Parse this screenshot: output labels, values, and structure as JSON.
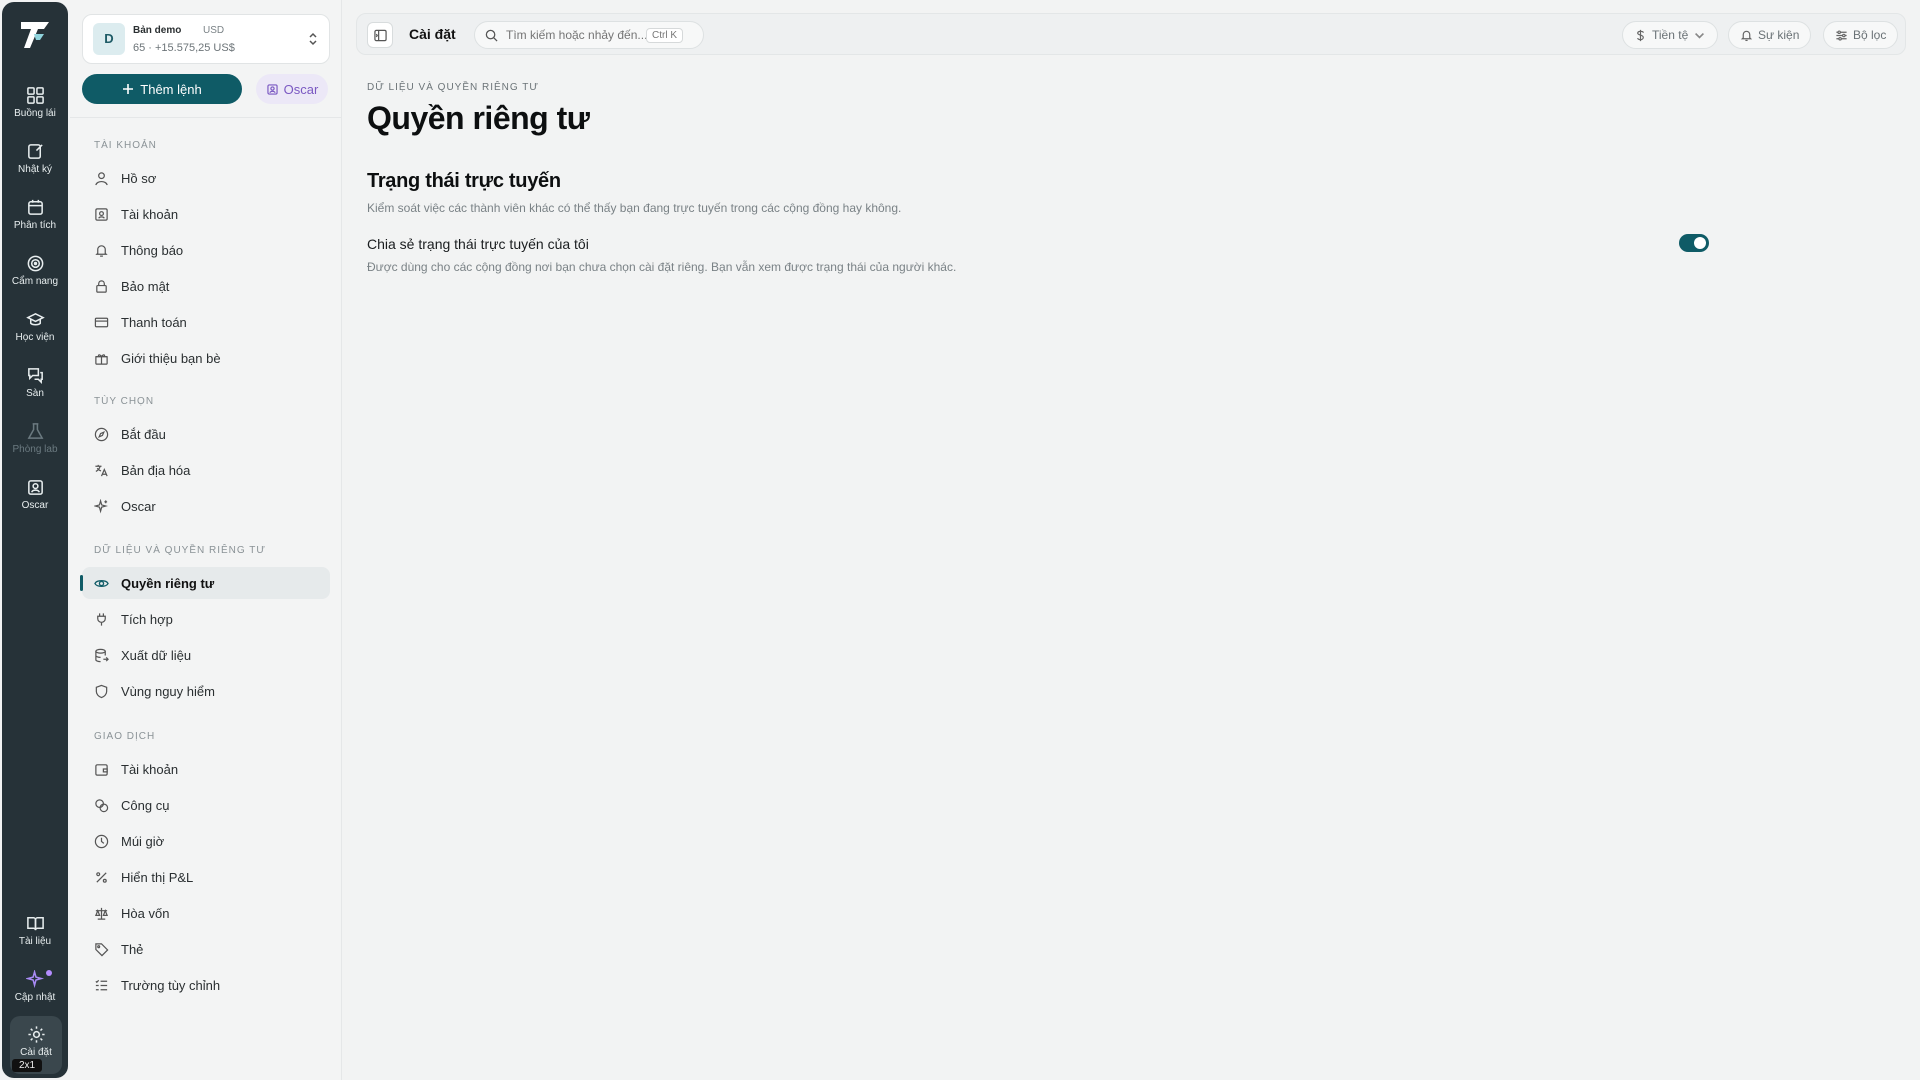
{
  "rail": {
    "items": [
      {
        "label": "Buồng lái",
        "icon": "dashboard-icon"
      },
      {
        "label": "Nhật ký",
        "icon": "journal-icon"
      },
      {
        "label": "Phân tích",
        "icon": "analytics-icon"
      },
      {
        "label": "Cẩm nang",
        "icon": "target-icon"
      },
      {
        "label": "Học viện",
        "icon": "graduation-cap-icon"
      },
      {
        "label": "Sàn",
        "icon": "chat-icon"
      },
      {
        "label": "Phòng lab",
        "icon": "flask-icon"
      },
      {
        "label": "Oscar",
        "icon": "oscar-icon"
      }
    ],
    "bottom": [
      {
        "label": "Tài liệu",
        "icon": "book-icon"
      },
      {
        "label": "Cập nhật",
        "icon": "sparkle-icon"
      }
    ],
    "settings_label": "Cài đặt",
    "zoom_badge": "2x1"
  },
  "account": {
    "avatar": "D",
    "name": "Bản demo",
    "currency": "USD",
    "summary": "65 · +15.575,25 US$"
  },
  "actions": {
    "add_order": "Thêm lệnh",
    "oscar": "Oscar"
  },
  "sidebar": {
    "sections": [
      {
        "title": "Tài khoản",
        "items": [
          "Hồ sơ",
          "Tài khoản",
          "Thông báo",
          "Bảo mật",
          "Thanh toán",
          "Giới thiệu bạn bè"
        ]
      },
      {
        "title": "Tùy chọn",
        "items": [
          "Bắt đầu",
          "Bản địa hóa",
          "Oscar"
        ]
      },
      {
        "title": "Dữ liệu và quyền riêng tư",
        "items": [
          "Quyền riêng tư",
          "Tích hợp",
          "Xuất dữ liệu",
          "Vùng nguy hiểm"
        ]
      },
      {
        "title": "Giao dịch",
        "items": [
          "Tài khoản",
          "Công cụ",
          "Múi giờ",
          "Hiển thị P&L",
          "Hòa vốn",
          "Thẻ",
          "Trường tùy chỉnh"
        ]
      }
    ],
    "active_item": "Quyền riêng tư"
  },
  "topbar": {
    "title": "Cài đặt",
    "search_placeholder": "Tìm kiếm hoặc nhảy đến...",
    "search_shortcut": "Ctrl K",
    "currency_btn": "Tiền tệ",
    "events_btn": "Sự kiện",
    "filter_btn": "Bộ lọc"
  },
  "main": {
    "breadcrumb": "Dữ liệu và quyền riêng tư",
    "title": "Quyền riêng tư",
    "section_title": "Trạng thái trực tuyến",
    "section_desc": "Kiểm soát việc các thành viên khác có thể thấy bạn đang trực tuyến trong các cộng đồng hay không.",
    "option_label": "Chia sẻ trạng thái trực tuyến của tôi",
    "option_desc": "Được dùng cho các cộng đồng nơi bạn chưa chọn cài đặt riêng. Bạn vẫn xem được trạng thái của người khác.",
    "option_enabled": true
  },
  "colors": {
    "accent": "#0f5b66",
    "rail_bg": "#263238",
    "oscar_purple": "#7a58c2"
  }
}
